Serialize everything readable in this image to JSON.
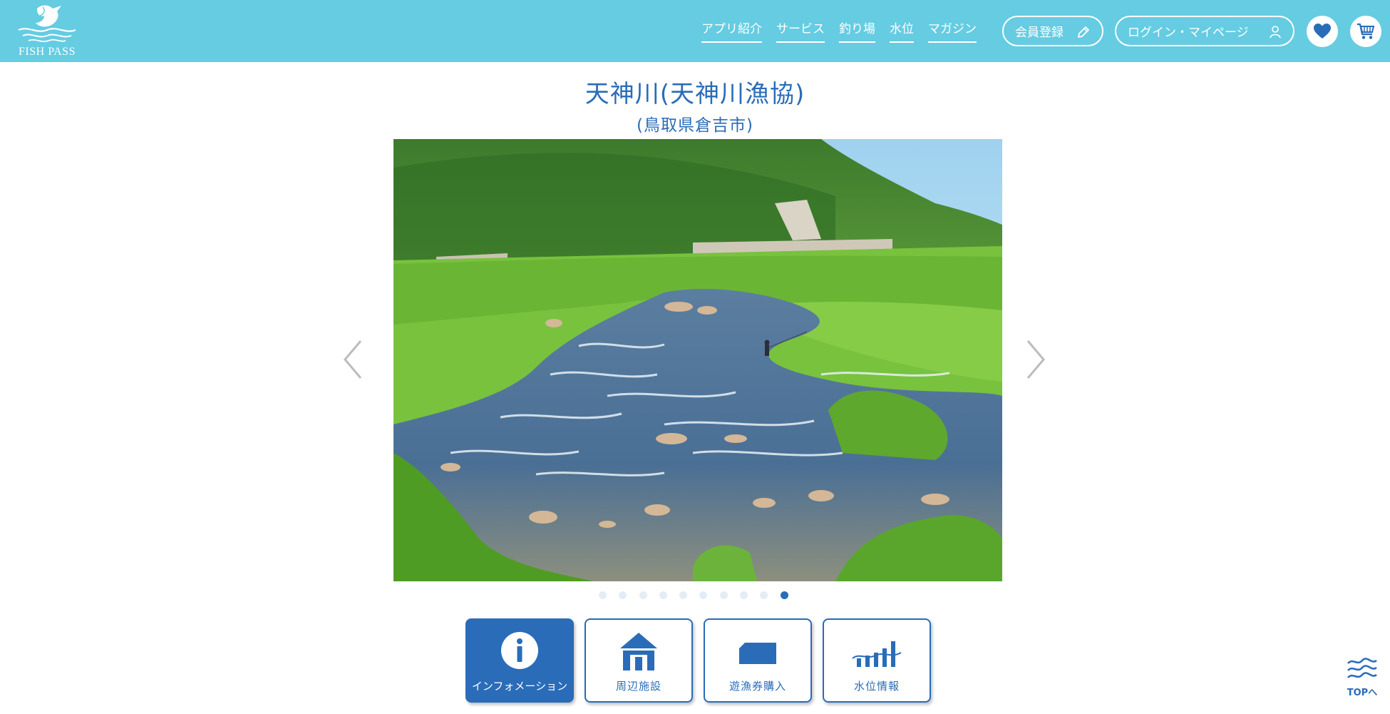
{
  "header": {
    "logo_text": "FISH PASS",
    "nav": [
      {
        "label": "アプリ紹介"
      },
      {
        "label": "サービス"
      },
      {
        "label": "釣り場"
      },
      {
        "label": "水位"
      },
      {
        "label": "マガジン"
      }
    ],
    "register_label": "会員登録",
    "login_label": "ログイン・マイページ",
    "favorite_icon": "heart-icon",
    "cart_icon": "cart-icon"
  },
  "page": {
    "title": "天神川(天神川漁協)",
    "subtitle": "(鳥取県倉吉市)"
  },
  "carousel": {
    "slide_count": 10,
    "active_index": 9
  },
  "tiles": [
    {
      "label": "インフォメーション",
      "icon": "info-icon",
      "active": true
    },
    {
      "label": "周辺施設",
      "icon": "house-icon",
      "active": false
    },
    {
      "label": "遊漁券購入",
      "icon": "ticket-icon",
      "active": false
    },
    {
      "label": "水位情報",
      "icon": "water-level-icon",
      "active": false
    }
  ],
  "back_to_top": {
    "label": "TOPへ"
  },
  "colors": {
    "header_bg": "#65cce2",
    "primary_blue": "#2a6cb8",
    "dot_inactive": "#e4edf6"
  }
}
